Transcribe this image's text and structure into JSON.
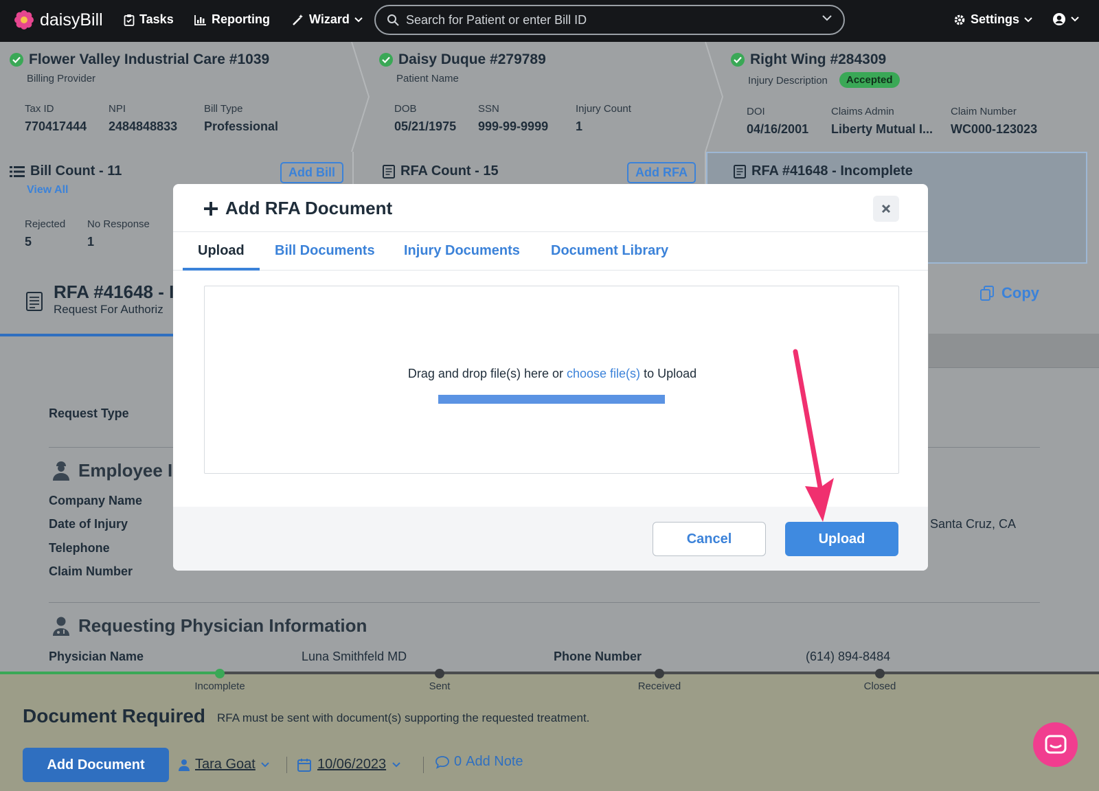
{
  "nav": {
    "brand": "daisyBill",
    "tasks": "Tasks",
    "reporting": "Reporting",
    "wizard": "Wizard",
    "search_placeholder": "Search for Patient or enter Bill ID",
    "settings": "Settings"
  },
  "summary": {
    "provider": {
      "title": "Flower Valley Industrial Care #1039",
      "subtitle": "Billing Provider",
      "fields": [
        {
          "label": "Tax ID",
          "value": "770417444"
        },
        {
          "label": "NPI",
          "value": "2484848833"
        },
        {
          "label": "Bill Type",
          "value": "Professional"
        }
      ]
    },
    "patient": {
      "title": "Daisy Duque #279789",
      "subtitle": "Patient Name",
      "fields": [
        {
          "label": "DOB",
          "value": "05/21/1975"
        },
        {
          "label": "SSN",
          "value": "999-99-9999"
        },
        {
          "label": "Injury Count",
          "value": "1"
        }
      ]
    },
    "injury": {
      "title": "Right Wing #284309",
      "subtitle": "Injury Description",
      "badge": "Accepted",
      "fields": [
        {
          "label": "DOI",
          "value": "04/16/2001"
        },
        {
          "label": "Claims Admin",
          "value": "Liberty Mutual I..."
        },
        {
          "label": "Claim Number",
          "value": "WC000-123023"
        }
      ]
    }
  },
  "cards": {
    "bill": {
      "title": "Bill Count - 11",
      "view_all": "View All",
      "add": "Add Bill",
      "stats": [
        {
          "label": "Rejected",
          "value": "5"
        },
        {
          "label": "No Response",
          "value": "1"
        }
      ]
    },
    "rfa": {
      "title": "RFA Count - 15",
      "add": "Add RFA"
    },
    "current": {
      "title": "RFA #41648 - Incomplete"
    }
  },
  "main": {
    "title": "RFA #41648 - I",
    "subtitle": "Request For Authoriz",
    "copy": "Copy",
    "request_type_label": "Request Type",
    "employee_section": "Employee I",
    "employee_rows": [
      {
        "label": "Company Name"
      },
      {
        "label": "Date of Injury"
      },
      {
        "label": "Telephone"
      },
      {
        "label": "Claim Number"
      }
    ],
    "right_city": "Santa Cruz, CA",
    "physician_section": "Requesting Physician Information",
    "physician_name_label": "Physician Name",
    "physician_name": "Luna Smithfeld MD",
    "phone_label": "Phone Number",
    "phone": "(614) 894-8484"
  },
  "timeline": {
    "steps": [
      "Incomplete",
      "Sent",
      "Received",
      "Closed"
    ],
    "doc_title": "Document Required",
    "doc_text": "RFA must be sent with document(s) supporting the requested treatment.",
    "add_document": "Add Document",
    "assignee": "Tara Goat",
    "date": "10/06/2023",
    "note_count": "0",
    "add_note": "Add Note"
  },
  "modal": {
    "title": "Add RFA Document",
    "tabs": [
      "Upload",
      "Bill Documents",
      "Injury Documents",
      "Document Library"
    ],
    "drop_prefix": "Drag and drop file(s) here or",
    "drop_link": "choose file(s)",
    "drop_suffix": "to Upload",
    "cancel": "Cancel",
    "upload": "Upload"
  },
  "colors": {
    "accent": "#3b82d9",
    "success": "#3aa856",
    "annotation_arrow": "#f0306f",
    "chat": "#f13d8f"
  }
}
